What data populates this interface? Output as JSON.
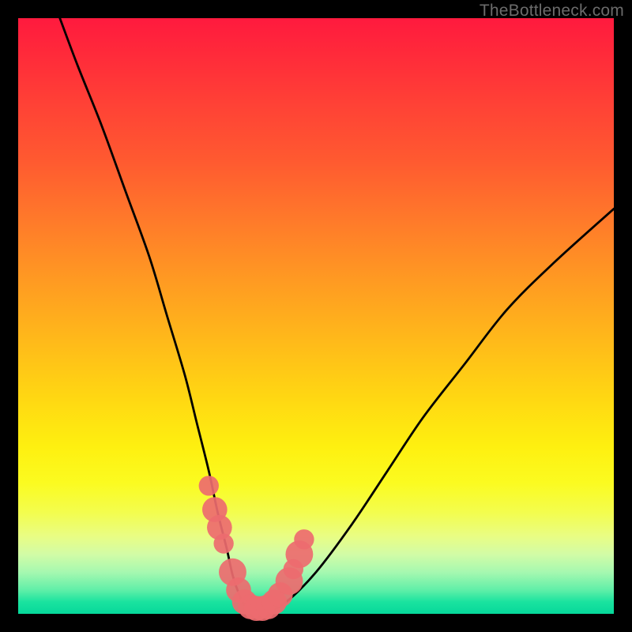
{
  "watermark": "TheBottleneck.com",
  "chart_data": {
    "type": "line",
    "title": "",
    "xlabel": "",
    "ylabel": "",
    "xlim": [
      0,
      100
    ],
    "ylim": [
      0,
      100
    ],
    "grid": false,
    "series": [
      {
        "name": "bottleneck-curve",
        "x": [
          7,
          10,
          14,
          18,
          22,
          25,
          28,
          30,
          32,
          33.5,
          35,
          36,
          37,
          38,
          39.5,
          42,
          45,
          50,
          56,
          62,
          68,
          75,
          82,
          90,
          100
        ],
        "values": [
          100,
          92,
          82,
          71,
          60,
          50,
          40,
          32,
          24,
          17,
          11,
          6.5,
          3.5,
          1.5,
          0.5,
          0.5,
          2,
          7,
          15,
          24,
          33,
          42,
          51,
          59,
          68
        ]
      }
    ],
    "markers": {
      "name": "highlight-points",
      "color": "#ed6b6f",
      "points": [
        {
          "x": 32.0,
          "y": 21.5,
          "r": 1.6
        },
        {
          "x": 33.0,
          "y": 17.5,
          "r": 2.0
        },
        {
          "x": 33.8,
          "y": 14.5,
          "r": 2.0
        },
        {
          "x": 34.5,
          "y": 11.8,
          "r": 1.6
        },
        {
          "x": 36.0,
          "y": 7.0,
          "r": 2.2
        },
        {
          "x": 37.0,
          "y": 4.0,
          "r": 2.0
        },
        {
          "x": 38.0,
          "y": 2.0,
          "r": 2.0
        },
        {
          "x": 39.0,
          "y": 1.2,
          "r": 2.0
        },
        {
          "x": 40.0,
          "y": 0.9,
          "r": 2.0
        },
        {
          "x": 41.0,
          "y": 0.9,
          "r": 2.0
        },
        {
          "x": 42.0,
          "y": 1.2,
          "r": 2.0
        },
        {
          "x": 43.0,
          "y": 2.0,
          "r": 2.0
        },
        {
          "x": 44.0,
          "y": 3.2,
          "r": 2.0
        },
        {
          "x": 45.5,
          "y": 5.5,
          "r": 2.2
        },
        {
          "x": 46.2,
          "y": 7.5,
          "r": 1.6
        },
        {
          "x": 47.2,
          "y": 10.0,
          "r": 2.2
        },
        {
          "x": 48.0,
          "y": 12.5,
          "r": 1.6
        }
      ]
    },
    "gradient_stops": [
      {
        "pos": 0,
        "color": "#ff1a3e"
      },
      {
        "pos": 50,
        "color": "#ffb91a"
      },
      {
        "pos": 78,
        "color": "#fbfb20"
      },
      {
        "pos": 100,
        "color": "#06d89a"
      }
    ]
  }
}
